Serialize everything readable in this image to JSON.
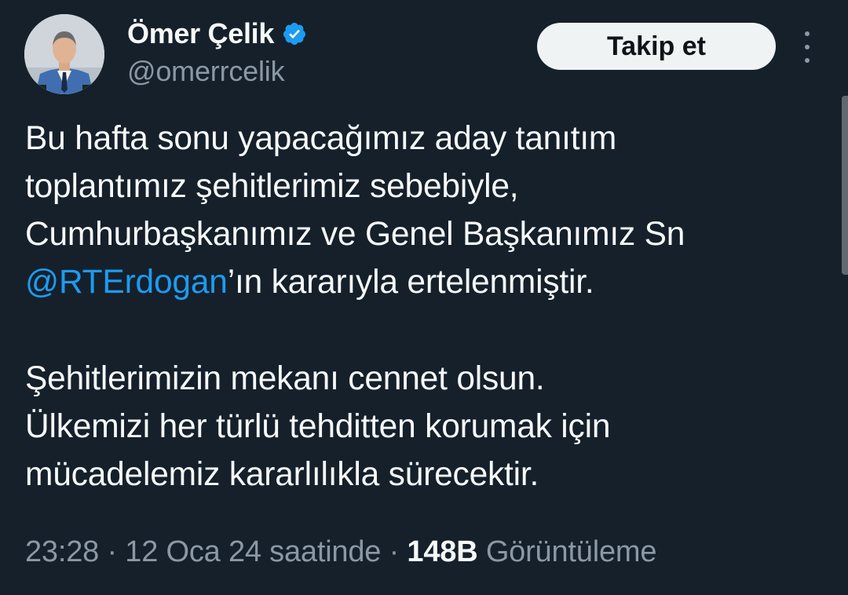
{
  "author": {
    "display_name": "Ömer Çelik",
    "handle": "@omerrcelik",
    "verified": true,
    "verified_color": "#1d9bf0"
  },
  "actions": {
    "follow_label": "Takip et",
    "more_icon": "more-vertical-icon"
  },
  "tweet": {
    "lines": [
      "Bu hafta sonu yapacağımız aday tanıtım",
      "toplantımız şehitlerimiz sebebiyle,",
      "Cumhurbaşkanımız ve Genel Başkanımız Sn"
    ],
    "mention": "@RTErdogan",
    "mention_suffix": "’ın kararıyla ertelenmiştir.",
    "paragraph2": [
      "Şehitlerimizin mekanı cennet olsun.",
      "Ülkemizi her türlü tehditten korumak için",
      "mücadelemiz kararlılıkla sürecektir."
    ]
  },
  "meta": {
    "time": "23:28",
    "sep1": " · ",
    "date": "12 Oca 24 saatinde",
    "sep2": " · ",
    "views_count": "148B",
    "views_label": "Görüntüleme"
  },
  "colors": {
    "background": "#15202b",
    "text_primary": "#f7f9f9",
    "text_secondary": "#8b98a5",
    "accent": "#1d9bf0"
  }
}
